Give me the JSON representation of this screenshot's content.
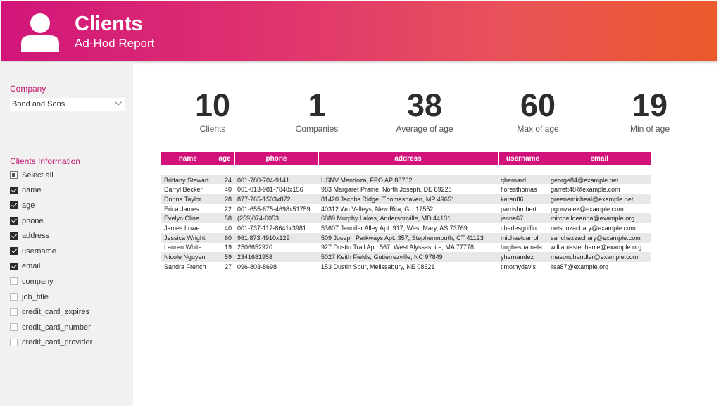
{
  "header": {
    "title": "Clients",
    "subtitle": "Ad-Hod Report"
  },
  "sidebar": {
    "company_label": "Company",
    "company_selected": "Bond and Sons",
    "clients_info_label": "Clients Information",
    "options": [
      {
        "label": "Select all",
        "state": "partial"
      },
      {
        "label": "name",
        "state": "checked"
      },
      {
        "label": "age",
        "state": "checked"
      },
      {
        "label": "phone",
        "state": "checked"
      },
      {
        "label": "address",
        "state": "checked"
      },
      {
        "label": "username",
        "state": "checked"
      },
      {
        "label": "email",
        "state": "checked"
      },
      {
        "label": "company",
        "state": "unchecked"
      },
      {
        "label": "job_title",
        "state": "unchecked"
      },
      {
        "label": "credit_card_expires",
        "state": "unchecked"
      },
      {
        "label": "credit_card_number",
        "state": "unchecked"
      },
      {
        "label": "credit_card_provider",
        "state": "unchecked"
      }
    ]
  },
  "kpis": [
    {
      "value": "10",
      "label": "Clients"
    },
    {
      "value": "1",
      "label": "Companies"
    },
    {
      "value": "38",
      "label": "Average of age"
    },
    {
      "value": "60",
      "label": "Max of age"
    },
    {
      "value": "19",
      "label": "Min of age"
    }
  ],
  "table": {
    "columns": [
      "name",
      "age",
      "phone",
      "address",
      "username",
      "email"
    ],
    "rows": [
      [
        "Brittany Stewart",
        "24",
        "001-780-704-9141",
        "USNV Mendoza, FPO AP 88762",
        "qbernard",
        "george84@example.net"
      ],
      [
        "Darryl Becker",
        "40",
        "001-013-981-7848x156",
        "983 Margaret Prairie, North Joseph, DE 89228",
        "floresthomas",
        "garrett48@example.com"
      ],
      [
        "Donna Taylor",
        "28",
        "877-765-1503x872",
        "81420 Jacobs Ridge, Thomashaven, MP 49651",
        "karen86",
        "greenemicheal@example.net"
      ],
      [
        "Erica James",
        "22",
        "001-655-675-4698x51759",
        "40312 Wu Valleys, New Rita, GU 17552",
        "parrishrobert",
        "pgonzalez@example.com"
      ],
      [
        "Evelyn Cline",
        "58",
        "(259)074-6053",
        "6889 Murphy Lakes, Andersonville, MD 44131",
        "jenna67",
        "mitchelldeanna@example.org"
      ],
      [
        "James Lowe",
        "40",
        "001-737-117-8641x3981",
        "53607 Jennifer Alley Apt. 917, West Mary, AS 73769",
        "charlesgriffin",
        "nelsonzachary@example.com"
      ],
      [
        "Jessica Wright",
        "60",
        "961.873.4910x129",
        "509 Joseph Parkways Apt. 357, Stephenmouth, CT 41123",
        "michaelcarroll",
        "sanchezzachary@example.com"
      ],
      [
        "Lauren White",
        "19",
        "2506652920",
        "927 Dustin Trail Apt. 567, West Alyssashire, MA 77778",
        "hughespamela",
        "williamsstephanie@example.org"
      ],
      [
        "Nicole Nguyen",
        "59",
        "2341681958",
        "5027 Keith Fields, Gutierrezville, NC 97849",
        "yhernandez",
        "masonchandler@example.com"
      ],
      [
        "Sandra French",
        "27",
        "096-803-8698",
        "153 Dustin Spur, Melissabury, NE 08521",
        "timothydavis",
        "lisa87@example.org"
      ]
    ]
  }
}
